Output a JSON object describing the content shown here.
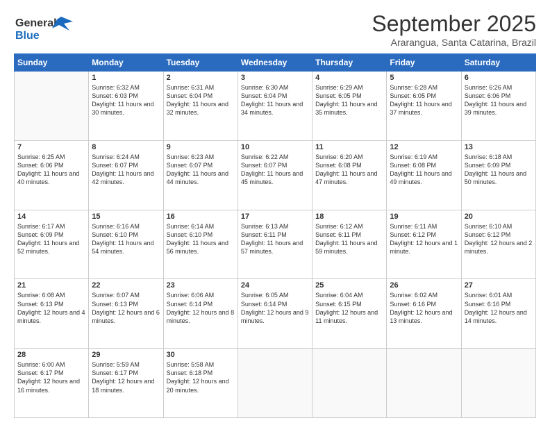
{
  "logo": {
    "general": "General",
    "blue": "Blue"
  },
  "title": "September 2025",
  "location": "Ararangua, Santa Catarina, Brazil",
  "days_header": [
    "Sunday",
    "Monday",
    "Tuesday",
    "Wednesday",
    "Thursday",
    "Friday",
    "Saturday"
  ],
  "weeks": [
    [
      {
        "day": "",
        "sunrise": "",
        "sunset": "",
        "daylight": ""
      },
      {
        "day": "1",
        "sunrise": "Sunrise: 6:32 AM",
        "sunset": "Sunset: 6:03 PM",
        "daylight": "Daylight: 11 hours and 30 minutes."
      },
      {
        "day": "2",
        "sunrise": "Sunrise: 6:31 AM",
        "sunset": "Sunset: 6:04 PM",
        "daylight": "Daylight: 11 hours and 32 minutes."
      },
      {
        "day": "3",
        "sunrise": "Sunrise: 6:30 AM",
        "sunset": "Sunset: 6:04 PM",
        "daylight": "Daylight: 11 hours and 34 minutes."
      },
      {
        "day": "4",
        "sunrise": "Sunrise: 6:29 AM",
        "sunset": "Sunset: 6:05 PM",
        "daylight": "Daylight: 11 hours and 35 minutes."
      },
      {
        "day": "5",
        "sunrise": "Sunrise: 6:28 AM",
        "sunset": "Sunset: 6:05 PM",
        "daylight": "Daylight: 11 hours and 37 minutes."
      },
      {
        "day": "6",
        "sunrise": "Sunrise: 6:26 AM",
        "sunset": "Sunset: 6:06 PM",
        "daylight": "Daylight: 11 hours and 39 minutes."
      }
    ],
    [
      {
        "day": "7",
        "sunrise": "Sunrise: 6:25 AM",
        "sunset": "Sunset: 6:06 PM",
        "daylight": "Daylight: 11 hours and 40 minutes."
      },
      {
        "day": "8",
        "sunrise": "Sunrise: 6:24 AM",
        "sunset": "Sunset: 6:07 PM",
        "daylight": "Daylight: 11 hours and 42 minutes."
      },
      {
        "day": "9",
        "sunrise": "Sunrise: 6:23 AM",
        "sunset": "Sunset: 6:07 PM",
        "daylight": "Daylight: 11 hours and 44 minutes."
      },
      {
        "day": "10",
        "sunrise": "Sunrise: 6:22 AM",
        "sunset": "Sunset: 6:07 PM",
        "daylight": "Daylight: 11 hours and 45 minutes."
      },
      {
        "day": "11",
        "sunrise": "Sunrise: 6:20 AM",
        "sunset": "Sunset: 6:08 PM",
        "daylight": "Daylight: 11 hours and 47 minutes."
      },
      {
        "day": "12",
        "sunrise": "Sunrise: 6:19 AM",
        "sunset": "Sunset: 6:08 PM",
        "daylight": "Daylight: 11 hours and 49 minutes."
      },
      {
        "day": "13",
        "sunrise": "Sunrise: 6:18 AM",
        "sunset": "Sunset: 6:09 PM",
        "daylight": "Daylight: 11 hours and 50 minutes."
      }
    ],
    [
      {
        "day": "14",
        "sunrise": "Sunrise: 6:17 AM",
        "sunset": "Sunset: 6:09 PM",
        "daylight": "Daylight: 11 hours and 52 minutes."
      },
      {
        "day": "15",
        "sunrise": "Sunrise: 6:16 AM",
        "sunset": "Sunset: 6:10 PM",
        "daylight": "Daylight: 11 hours and 54 minutes."
      },
      {
        "day": "16",
        "sunrise": "Sunrise: 6:14 AM",
        "sunset": "Sunset: 6:10 PM",
        "daylight": "Daylight: 11 hours and 56 minutes."
      },
      {
        "day": "17",
        "sunrise": "Sunrise: 6:13 AM",
        "sunset": "Sunset: 6:11 PM",
        "daylight": "Daylight: 11 hours and 57 minutes."
      },
      {
        "day": "18",
        "sunrise": "Sunrise: 6:12 AM",
        "sunset": "Sunset: 6:11 PM",
        "daylight": "Daylight: 11 hours and 59 minutes."
      },
      {
        "day": "19",
        "sunrise": "Sunrise: 6:11 AM",
        "sunset": "Sunset: 6:12 PM",
        "daylight": "Daylight: 12 hours and 1 minute."
      },
      {
        "day": "20",
        "sunrise": "Sunrise: 6:10 AM",
        "sunset": "Sunset: 6:12 PM",
        "daylight": "Daylight: 12 hours and 2 minutes."
      }
    ],
    [
      {
        "day": "21",
        "sunrise": "Sunrise: 6:08 AM",
        "sunset": "Sunset: 6:13 PM",
        "daylight": "Daylight: 12 hours and 4 minutes."
      },
      {
        "day": "22",
        "sunrise": "Sunrise: 6:07 AM",
        "sunset": "Sunset: 6:13 PM",
        "daylight": "Daylight: 12 hours and 6 minutes."
      },
      {
        "day": "23",
        "sunrise": "Sunrise: 6:06 AM",
        "sunset": "Sunset: 6:14 PM",
        "daylight": "Daylight: 12 hours and 8 minutes."
      },
      {
        "day": "24",
        "sunrise": "Sunrise: 6:05 AM",
        "sunset": "Sunset: 6:14 PM",
        "daylight": "Daylight: 12 hours and 9 minutes."
      },
      {
        "day": "25",
        "sunrise": "Sunrise: 6:04 AM",
        "sunset": "Sunset: 6:15 PM",
        "daylight": "Daylight: 12 hours and 11 minutes."
      },
      {
        "day": "26",
        "sunrise": "Sunrise: 6:02 AM",
        "sunset": "Sunset: 6:16 PM",
        "daylight": "Daylight: 12 hours and 13 minutes."
      },
      {
        "day": "27",
        "sunrise": "Sunrise: 6:01 AM",
        "sunset": "Sunset: 6:16 PM",
        "daylight": "Daylight: 12 hours and 14 minutes."
      }
    ],
    [
      {
        "day": "28",
        "sunrise": "Sunrise: 6:00 AM",
        "sunset": "Sunset: 6:17 PM",
        "daylight": "Daylight: 12 hours and 16 minutes."
      },
      {
        "day": "29",
        "sunrise": "Sunrise: 5:59 AM",
        "sunset": "Sunset: 6:17 PM",
        "daylight": "Daylight: 12 hours and 18 minutes."
      },
      {
        "day": "30",
        "sunrise": "Sunrise: 5:58 AM",
        "sunset": "Sunset: 6:18 PM",
        "daylight": "Daylight: 12 hours and 20 minutes."
      },
      {
        "day": "",
        "sunrise": "",
        "sunset": "",
        "daylight": ""
      },
      {
        "day": "",
        "sunrise": "",
        "sunset": "",
        "daylight": ""
      },
      {
        "day": "",
        "sunrise": "",
        "sunset": "",
        "daylight": ""
      },
      {
        "day": "",
        "sunrise": "",
        "sunset": "",
        "daylight": ""
      }
    ]
  ]
}
